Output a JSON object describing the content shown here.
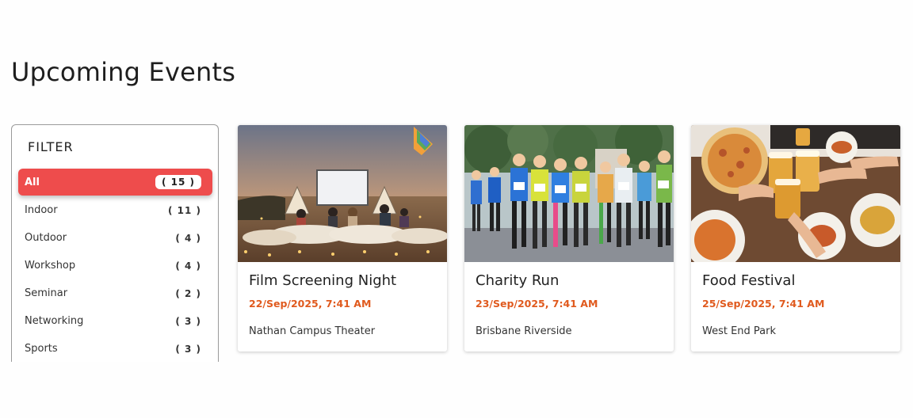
{
  "page": {
    "title": "Upcoming Events"
  },
  "filter": {
    "title": "FILTER",
    "items": [
      {
        "label": "All",
        "count": "( 15 )",
        "active": true
      },
      {
        "label": "Indoor",
        "count": "( 11 )",
        "active": false
      },
      {
        "label": "Outdoor",
        "count": "( 4 )",
        "active": false
      },
      {
        "label": "Workshop",
        "count": "( 4 )",
        "active": false
      },
      {
        "label": "Seminar",
        "count": "( 2 )",
        "active": false
      },
      {
        "label": "Networking",
        "count": "( 3 )",
        "active": false
      },
      {
        "label": "Sports",
        "count": "( 3 )",
        "active": false
      }
    ]
  },
  "events": [
    {
      "title": "Film Screening Night",
      "date": "22/Sep/2025, 7:41 AM",
      "venue": "Nathan Campus Theater",
      "image": "outdoor-movie-photo"
    },
    {
      "title": "Charity Run",
      "date": "23/Sep/2025, 7:41 AM",
      "venue": "Brisbane Riverside",
      "image": "marathon-runners-photo"
    },
    {
      "title": "Food Festival",
      "date": "25/Sep/2025, 7:41 AM",
      "venue": "West End Park",
      "image": "pizza-beer-photo"
    }
  ],
  "colors": {
    "accent": "#ee4c4c",
    "date": "#e05a1e"
  }
}
